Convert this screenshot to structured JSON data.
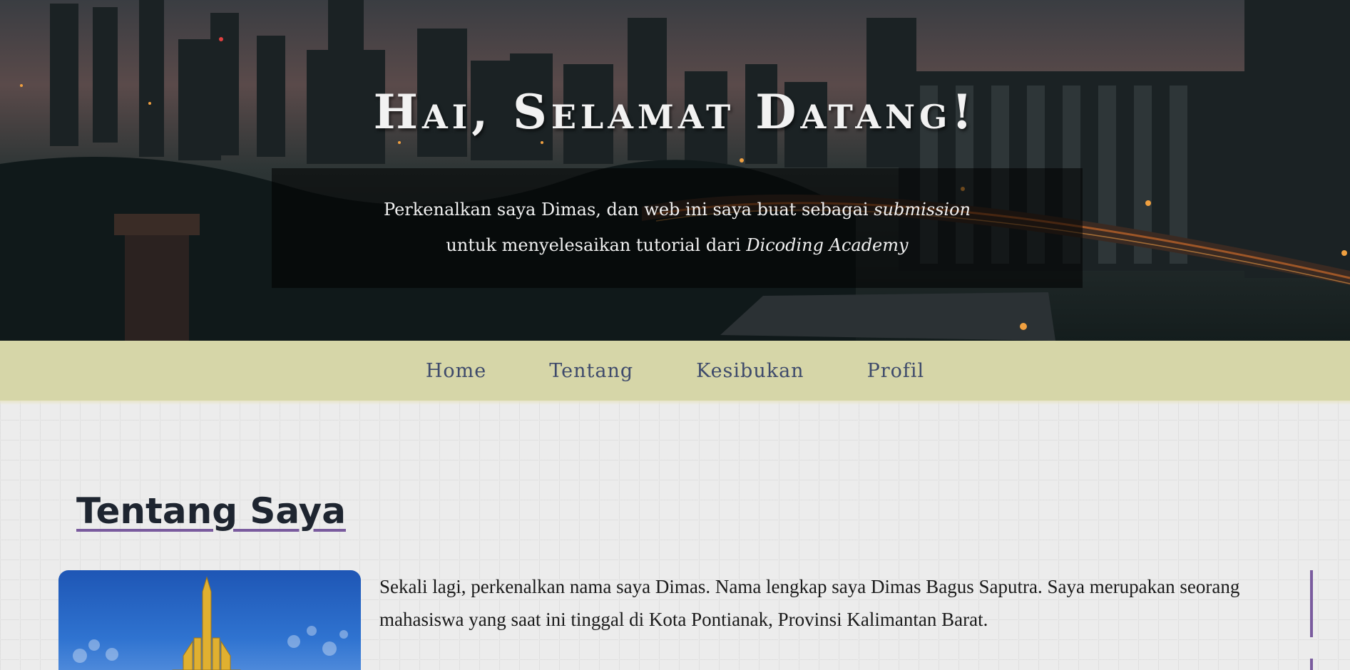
{
  "hero": {
    "title": "Hai, Selamat Datang!",
    "intro_line1_prefix": "Perkenalkan saya Dimas, dan web ini saya buat sebagai ",
    "intro_line1_em": "submission",
    "intro_line2_prefix": "untuk menyelesaikan tutorial dari ",
    "intro_line2_em": "Dicoding Academy"
  },
  "nav": {
    "items": [
      {
        "label": "Home"
      },
      {
        "label": "Tentang"
      },
      {
        "label": "Kesibukan"
      },
      {
        "label": "Profil"
      }
    ]
  },
  "about": {
    "title": "Tentang Saya",
    "paragraph1": "Sekali lagi, perkenalkan nama saya Dimas. Nama lengkap saya Dimas Bagus Saputra. Saya merupakan seorang mahasiswa yang saat ini tinggal di Kota Pontianak, Provinsi Kalimantan Barat."
  },
  "colors": {
    "nav_background": "#d6d6a8",
    "nav_link": "#3e4a6b",
    "accent": "#7a5b9e"
  }
}
